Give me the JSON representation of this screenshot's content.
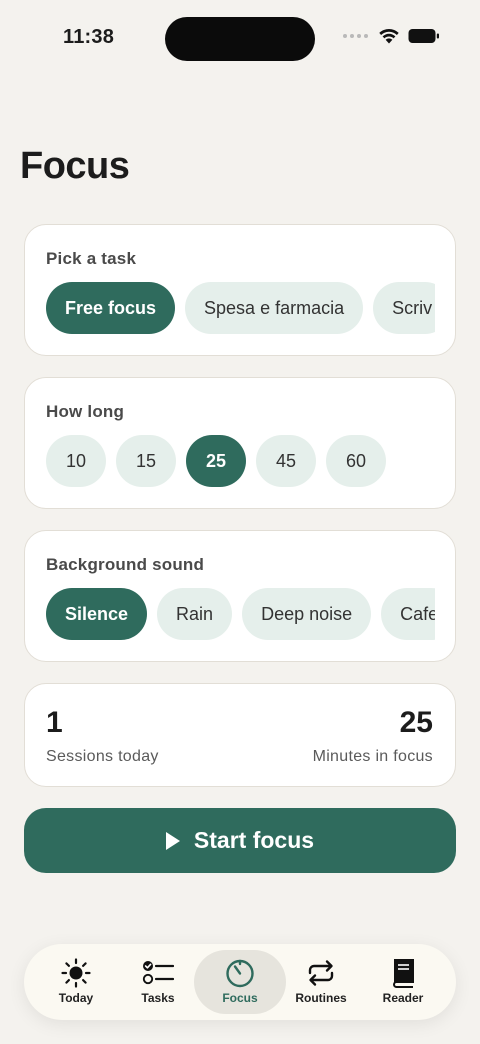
{
  "status": {
    "time": "11:38"
  },
  "page": {
    "title": "Focus"
  },
  "task_card": {
    "title": "Pick a task",
    "chips": [
      {
        "label": "Free focus",
        "selected": true
      },
      {
        "label": "Spesa e farmacia",
        "selected": false
      },
      {
        "label": "Scriv",
        "selected": false
      }
    ]
  },
  "duration_card": {
    "title": "How long",
    "options": [
      {
        "label": "10",
        "selected": false
      },
      {
        "label": "15",
        "selected": false
      },
      {
        "label": "25",
        "selected": true
      },
      {
        "label": "45",
        "selected": false
      },
      {
        "label": "60",
        "selected": false
      }
    ]
  },
  "sound_card": {
    "title": "Background sound",
    "chips": [
      {
        "label": "Silence",
        "selected": true
      },
      {
        "label": "Rain",
        "selected": false
      },
      {
        "label": "Deep noise",
        "selected": false
      },
      {
        "label": "Cafe",
        "selected": false
      }
    ]
  },
  "stats": {
    "sessions_value": "1",
    "sessions_label": "Sessions today",
    "minutes_value": "25",
    "minutes_label": "Minutes in focus"
  },
  "start_button": {
    "label": "Start focus",
    "icon": "play-icon"
  },
  "tabbar": {
    "active": "Focus",
    "tabs": [
      {
        "label": "Today",
        "icon": "sun-icon"
      },
      {
        "label": "Tasks",
        "icon": "checklist-icon"
      },
      {
        "label": "Focus",
        "icon": "timer-icon"
      },
      {
        "label": "Routines",
        "icon": "repeat-icon"
      },
      {
        "label": "Reader",
        "icon": "book-icon"
      }
    ]
  },
  "colors": {
    "accent": "#2f6b5d",
    "chip_bg": "#e5efeb",
    "background": "#f4f2ee",
    "card": "#ffffff"
  }
}
